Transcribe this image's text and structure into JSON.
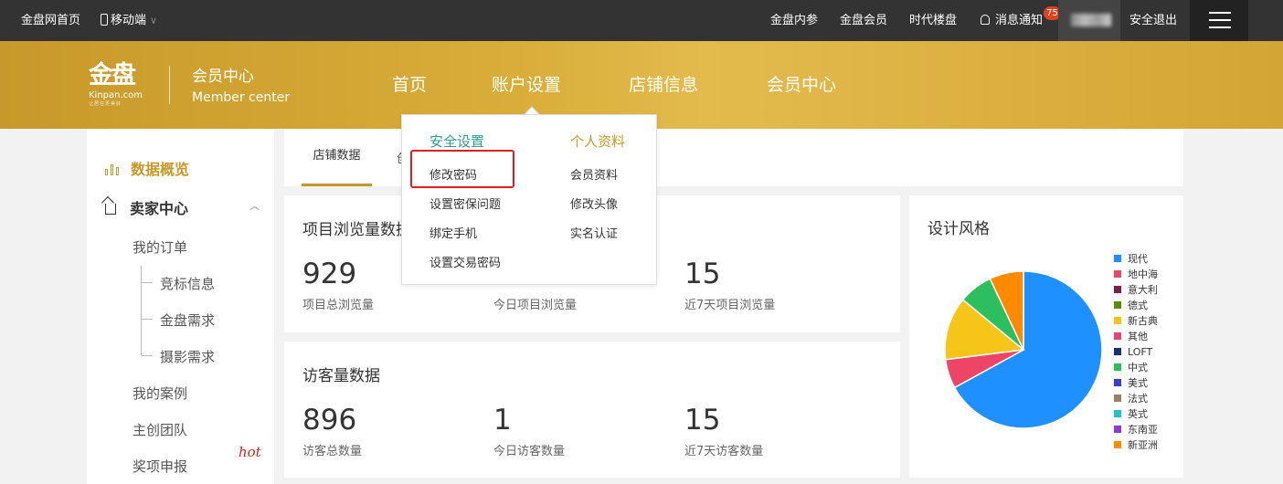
{
  "topbar": {
    "home": "金盘网首页",
    "mobile": "移动端",
    "links": [
      "金盘内参",
      "金盘会员",
      "时代楼盘"
    ],
    "messages": "消息通知",
    "badge": "75",
    "logout": "安全退出"
  },
  "header": {
    "logo_mark": "金盘",
    "logo_en": "Kinpan.com",
    "logo_slogan": "让居住更美好",
    "title": "会员中心",
    "subtitle": "Member center",
    "nav": [
      "首页",
      "账户设置",
      "店铺信息",
      "会员中心"
    ]
  },
  "sidebar": {
    "overview": "数据概览",
    "seller_center": "卖家中心",
    "items": [
      "我的订单",
      "竞标信息",
      "金盘需求",
      "摄影需求",
      "我的案例",
      "主创团队",
      "奖项申报"
    ],
    "hot": "hot"
  },
  "tabs": {
    "active": "店铺数据",
    "partial": "创"
  },
  "dropdown": {
    "col1_title": "安全设置",
    "col1": [
      "修改密码",
      "设置密保问题",
      "绑定手机",
      "设置交易密码"
    ],
    "col2_title": "个人资料",
    "col2": [
      "会员资料",
      "修改头像",
      "实名认证"
    ]
  },
  "views": {
    "title": "项目浏览量数据",
    "stats": [
      {
        "value": "929",
        "label": "项目总浏览量"
      },
      {
        "value": "",
        "label": "今日项目浏览量"
      },
      {
        "value": "15",
        "label": "近7天项目浏览量"
      }
    ]
  },
  "visitors": {
    "title": "访客量数据",
    "stats": [
      {
        "value": "896",
        "label": "访客总数量"
      },
      {
        "value": "1",
        "label": "今日访客数量"
      },
      {
        "value": "15",
        "label": "近7天访客数量"
      }
    ]
  },
  "chart_data": {
    "type": "pie",
    "title": "设计风格",
    "legend_position": "right",
    "categories": [
      "现代",
      "地中海",
      "意大利",
      "德式",
      "新古典",
      "其他",
      "LOFT",
      "中式",
      "美式",
      "法式",
      "英式",
      "东南亚",
      "新亚洲"
    ],
    "colors": [
      "#1e90ff",
      "#ee4466",
      "#7b1f4a",
      "#5b8c00",
      "#f5c518",
      "#e8437a",
      "#1a2f6e",
      "#2dbe60",
      "#3b3bd1",
      "#9b8060",
      "#22c3c3",
      "#8a3be0",
      "#ff8a00"
    ],
    "values": [
      67,
      6,
      0,
      0,
      13,
      0,
      0,
      7,
      0,
      0,
      0,
      0,
      7
    ]
  }
}
